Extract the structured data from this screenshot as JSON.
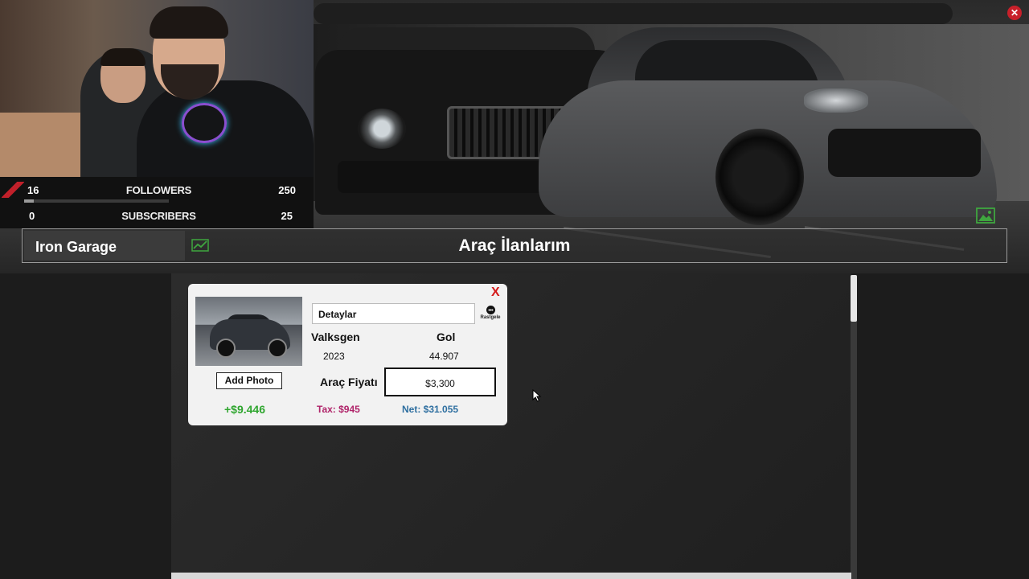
{
  "stream": {
    "followers": {
      "current": "16",
      "label": "FOLLOWERS",
      "goal": "250",
      "progress": 0.064
    },
    "subscribers": {
      "current": "0",
      "label": "SUBSCRIBERS",
      "goal": "25",
      "progress": 0.0
    }
  },
  "header": {
    "garage_name": "Iron Garage",
    "page_title": "Araç İlanlarım"
  },
  "listing": {
    "details_placeholder": "Detaylar",
    "random_label": "Rastgele",
    "brand": "Valksgen",
    "model": "Gol",
    "year": "2023",
    "km": "44.907",
    "add_photo_label": "Add Photo",
    "price_label": "Araç Fiyatı",
    "price_value": "$3,300",
    "profit": "+$9.446",
    "tax": "Tax: $945",
    "net": "Net: $31.055"
  },
  "colors": {
    "close_red": "#c8202a",
    "profit_green": "#2fa62f",
    "tax_magenta": "#b0246a",
    "net_blue": "#2e6fa0"
  },
  "icons": {
    "window_close": "close-icon",
    "card_close": "close-icon",
    "trend": "trend-chart-icon",
    "image": "image-icon",
    "random": "dice-icon"
  },
  "glyphs": {
    "close": "✕",
    "card_close": "X"
  }
}
